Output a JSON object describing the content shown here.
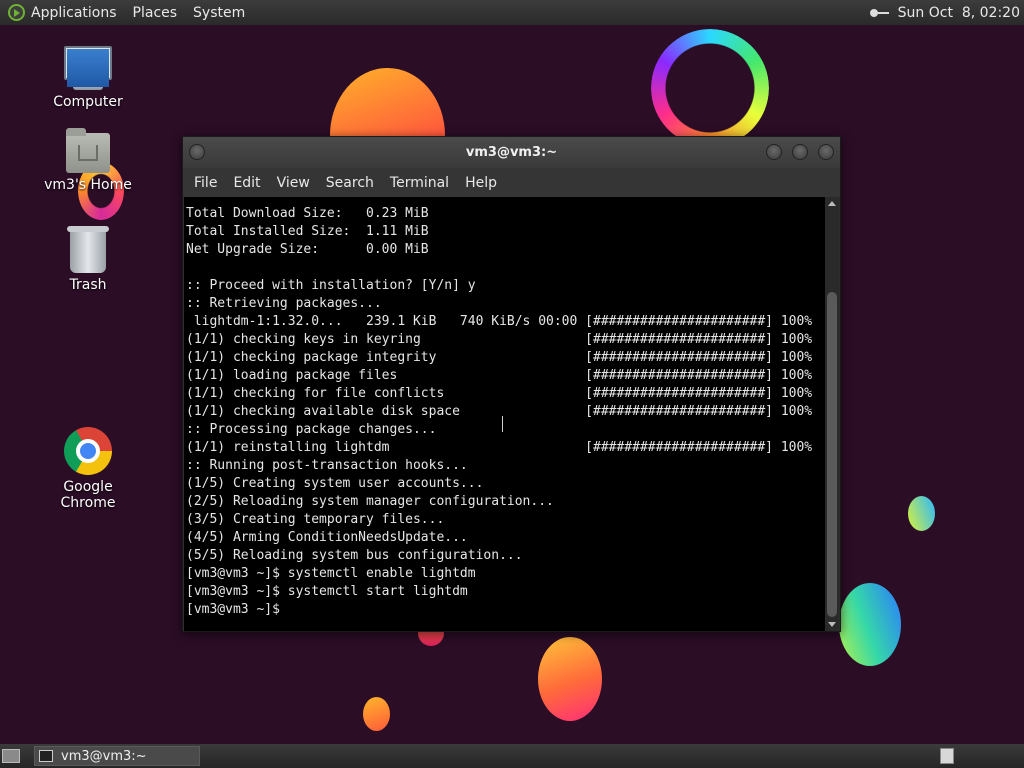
{
  "top_panel": {
    "menus": [
      "Applications",
      "Places",
      "System"
    ],
    "clock": "Sun Oct  8, 02:20"
  },
  "desktop_icons": [
    {
      "label": "Computer",
      "icon": "computer-icon"
    },
    {
      "label": "vm3's Home",
      "icon": "home-folder-icon"
    },
    {
      "label": "Trash",
      "icon": "trash-icon"
    },
    {
      "label": "Google Chrome",
      "icon": "chrome-icon"
    }
  ],
  "terminal": {
    "title": "vm3@vm3:~",
    "menu": [
      "File",
      "Edit",
      "View",
      "Search",
      "Terminal",
      "Help"
    ],
    "lines": [
      "Total Download Size:   0.23 MiB",
      "Total Installed Size:  1.11 MiB",
      "Net Upgrade Size:      0.00 MiB",
      "",
      ":: Proceed with installation? [Y/n] y",
      ":: Retrieving packages...",
      " lightdm-1:1.32.0...   239.1 KiB   740 KiB/s 00:00 [######################] 100%",
      "(1/1) checking keys in keyring                     [######################] 100%",
      "(1/1) checking package integrity                   [######################] 100%",
      "(1/1) loading package files                        [######################] 100%",
      "(1/1) checking for file conflicts                  [######################] 100%",
      "(1/1) checking available disk space                [######################] 100%",
      ":: Processing package changes...",
      "(1/1) reinstalling lightdm                         [######################] 100%",
      ":: Running post-transaction hooks...",
      "(1/5) Creating system user accounts...",
      "(2/5) Reloading system manager configuration...",
      "(3/5) Creating temporary files...",
      "(4/5) Arming ConditionNeedsUpdate...",
      "(5/5) Reloading system bus configuration...",
      "[vm3@vm3 ~]$ systemctl enable lightdm",
      "[vm3@vm3 ~]$ systemctl start lightdm",
      "[vm3@vm3 ~]$ "
    ]
  },
  "taskbar": {
    "window_button": "vm3@vm3:~"
  },
  "colors": {
    "desktop_bg": "#2b0d26",
    "terminal_bg": "#000000",
    "terminal_fg": "#e6e6e6",
    "panel_bg": "#333333"
  }
}
